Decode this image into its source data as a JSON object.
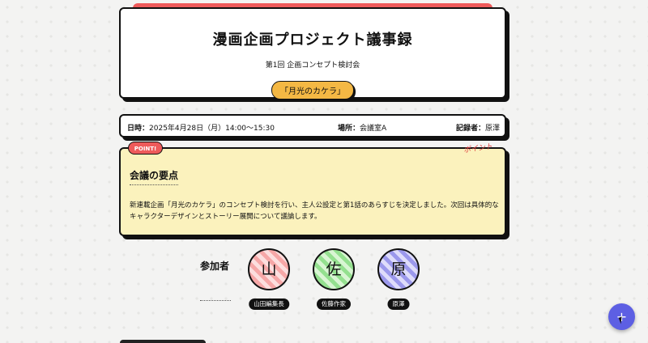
{
  "header": {
    "title": "漫画企画プロジェクト議事録",
    "subtitle": "第1回 企画コンセプト検討会",
    "tag": "「月光のカケラ」"
  },
  "info": {
    "date_label": "日時：",
    "date_value": "2025年4月28日（月）14:00〜15:30",
    "place_label": "場所：",
    "place_value": "会議室A",
    "recorder_label": "記録者：",
    "recorder_value": "原澤"
  },
  "summary": {
    "badge": "POINT!",
    "sketch": "ポイント",
    "title": "会議の要点",
    "text": "新連載企画「月光のカケラ」のコンセプト検討を行い、主人公設定と第1話のあらすじを決定しました。次回は具体的なキャラクターデザインとストーリー展開について議論します。"
  },
  "participants": {
    "label": "参加者",
    "people": [
      {
        "initial": "山",
        "name": "山田編集長"
      },
      {
        "initial": "佐",
        "name": "佐藤作家"
      },
      {
        "initial": "原",
        "name": "原澤"
      }
    ]
  },
  "fab": {
    "label": "+"
  },
  "colors": {
    "accent_red": "#ee5a5a",
    "tag_yellow": "#f4b844",
    "summary_bg": "#fbf2bd",
    "fab_purple": "#5d5fe3"
  }
}
